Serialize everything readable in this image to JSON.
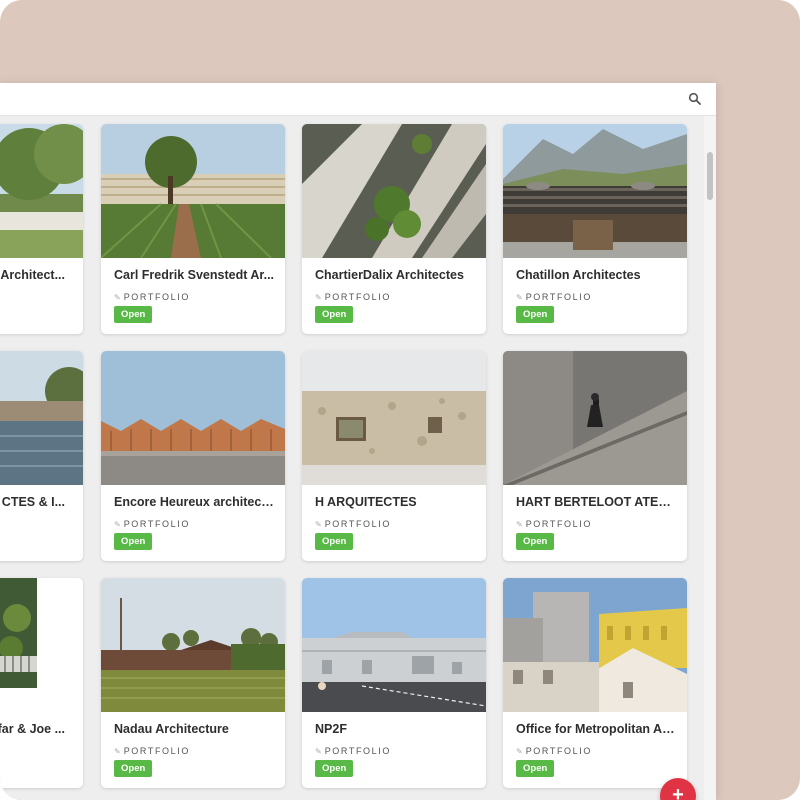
{
  "topbar": {
    "search_icon": "search-icon"
  },
  "badge_label": "Open",
  "category_label": "PORTFOLIO",
  "cards": [
    {
      "title": "Architect..."
    },
    {
      "title": "Carl Fredrik Svenstedt Ar..."
    },
    {
      "title": "ChartierDalix Architectes"
    },
    {
      "title": "Chatillon Architectes"
    },
    {
      "title": "CTES & I..."
    },
    {
      "title": "Encore Heureux architect..."
    },
    {
      "title": "H ARQUITECTES"
    },
    {
      "title": "HART BERTELOOT ATELI..."
    },
    {
      "title": "ffar & Joe ..."
    },
    {
      "title": "Nadau Architecture"
    },
    {
      "title": "NP2F"
    },
    {
      "title": "Office for Metropolitan Ar..."
    }
  ],
  "fab_label": "+",
  "colors": {
    "background": "#dcc8bd",
    "badge": "#58b947",
    "fab": "#e03445"
  }
}
